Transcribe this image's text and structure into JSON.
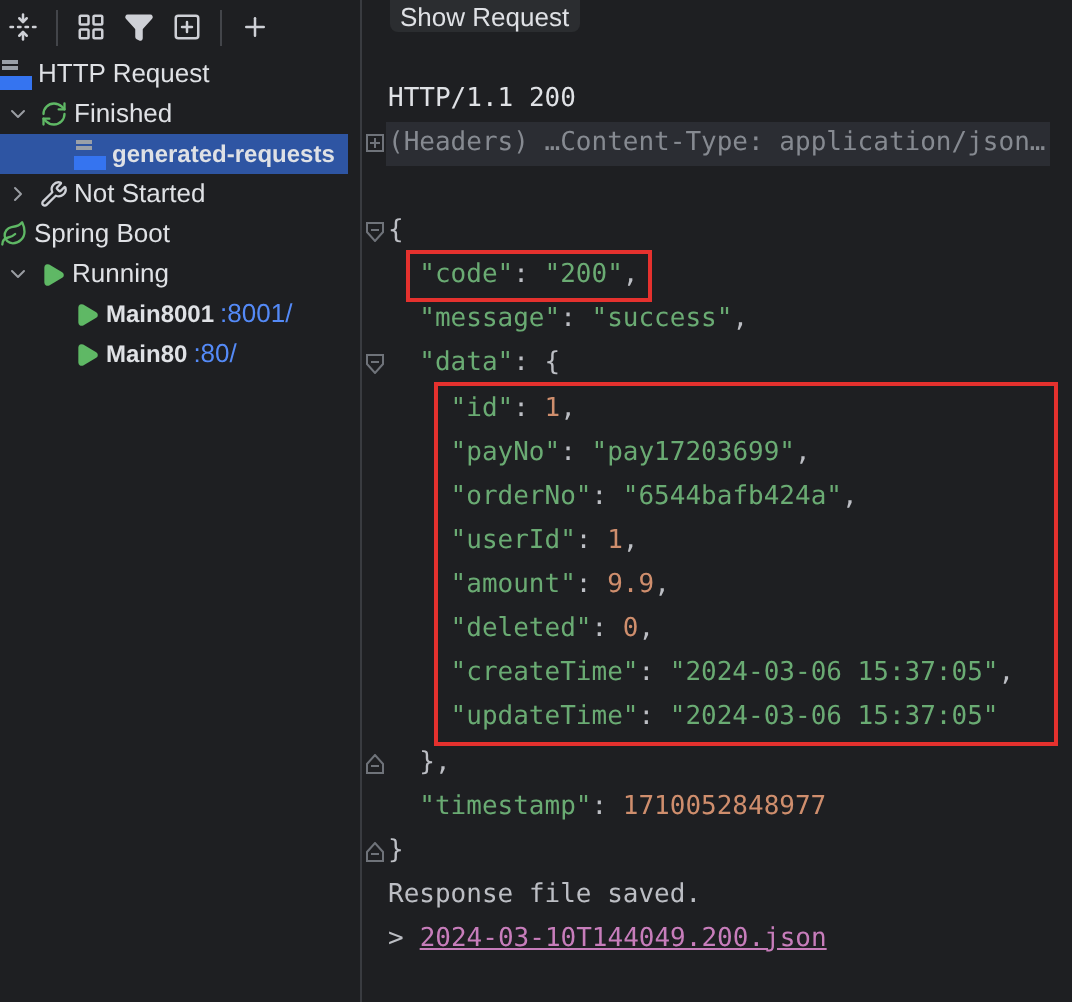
{
  "tree": [
    {
      "label": "HTTP Request",
      "kind": "api",
      "children": [
        {
          "label": "Finished",
          "kind": "refresh",
          "expanded": true,
          "children": [
            {
              "label": "generated-requests",
              "kind": "api",
              "bold": true,
              "selected": true
            }
          ]
        },
        {
          "label": "Not Started",
          "kind": "wrench",
          "expanded": false
        }
      ]
    },
    {
      "label": "Spring Boot",
      "kind": "spring",
      "children": [
        {
          "label": "Running",
          "kind": "run",
          "expanded": true,
          "children": [
            {
              "label": "Main8001",
              "suffix": ":8001/",
              "kind": "run",
              "bold": true,
              "selected": false
            },
            {
              "label": "Main80",
              "suffix": ":80/",
              "kind": "run",
              "bold": true,
              "selected": false
            }
          ]
        }
      ]
    }
  ],
  "show_request_button": "Show Request",
  "status_line": "HTTP/1.1 200",
  "headers_line": "(Headers) …Content-Type: application/json…",
  "body": [
    {
      "kind": "opener",
      "tokens": [
        {
          "kind": "punct",
          "text": "{"
        }
      ],
      "children": [
        {
          "highlighted": true,
          "tokens": [
            {
              "kind": "key",
              "text": "\"code\""
            },
            {
              "kind": "punct",
              "text": ": "
            },
            {
              "kind": "string",
              "text": "\"200\""
            },
            {
              "kind": "punct",
              "text": ","
            }
          ]
        },
        {
          "tokens": [
            {
              "kind": "key",
              "text": "\"message\""
            },
            {
              "kind": "punct",
              "text": ": "
            },
            {
              "kind": "string",
              "text": "\"success\""
            },
            {
              "kind": "punct",
              "text": ","
            }
          ]
        },
        {
          "kind": "opener",
          "tokens": [
            {
              "kind": "key",
              "text": "\"data\""
            },
            {
              "kind": "punct",
              "text": ": {"
            }
          ],
          "children_highlighted": true,
          "children": [
            {
              "tokens": [
                {
                  "kind": "key",
                  "text": "\"id\""
                },
                {
                  "kind": "punct",
                  "text": ": "
                },
                {
                  "kind": "number",
                  "text": "1"
                },
                {
                  "kind": "punct",
                  "text": ","
                }
              ]
            },
            {
              "tokens": [
                {
                  "kind": "key",
                  "text": "\"payNo\""
                },
                {
                  "kind": "punct",
                  "text": ": "
                },
                {
                  "kind": "string",
                  "text": "\"pay17203699\""
                },
                {
                  "kind": "punct",
                  "text": ","
                }
              ]
            },
            {
              "tokens": [
                {
                  "kind": "key",
                  "text": "\"orderNo\""
                },
                {
                  "kind": "punct",
                  "text": ": "
                },
                {
                  "kind": "string",
                  "text": "\"6544bafb424a\""
                },
                {
                  "kind": "punct",
                  "text": ","
                }
              ]
            },
            {
              "tokens": [
                {
                  "kind": "key",
                  "text": "\"userId\""
                },
                {
                  "kind": "punct",
                  "text": ": "
                },
                {
                  "kind": "number",
                  "text": "1"
                },
                {
                  "kind": "punct",
                  "text": ","
                }
              ]
            },
            {
              "tokens": [
                {
                  "kind": "key",
                  "text": "\"amount\""
                },
                {
                  "kind": "punct",
                  "text": ": "
                },
                {
                  "kind": "number",
                  "text": "9.9"
                },
                {
                  "kind": "punct",
                  "text": ","
                }
              ]
            },
            {
              "tokens": [
                {
                  "kind": "key",
                  "text": "\"deleted\""
                },
                {
                  "kind": "punct",
                  "text": ": "
                },
                {
                  "kind": "number",
                  "text": "0"
                },
                {
                  "kind": "punct",
                  "text": ","
                }
              ]
            },
            {
              "tokens": [
                {
                  "kind": "key",
                  "text": "\"createTime\""
                },
                {
                  "kind": "punct",
                  "text": ": "
                },
                {
                  "kind": "string",
                  "text": "\"2024-03-06 15:37:05\""
                },
                {
                  "kind": "punct",
                  "text": ","
                }
              ]
            },
            {
              "tokens": [
                {
                  "kind": "key",
                  "text": "\"updateTime\""
                },
                {
                  "kind": "punct",
                  "text": ": "
                },
                {
                  "kind": "string",
                  "text": "\"2024-03-06 15:37:05\""
                }
              ]
            }
          ]
        },
        {
          "kind": "closer",
          "tokens": [
            {
              "kind": "punct",
              "text": "},"
            }
          ]
        },
        {
          "tokens": [
            {
              "kind": "key",
              "text": "\"timestamp\""
            },
            {
              "kind": "punct",
              "text": ": "
            },
            {
              "kind": "number",
              "text": "1710052848977"
            }
          ]
        }
      ]
    },
    {
      "kind": "closer",
      "tokens": [
        {
          "kind": "punct",
          "text": "}"
        }
      ]
    }
  ],
  "saved_message": "Response file saved.",
  "link_prompt": ">",
  "saved_file_link": "2024-03-10T144049.200.json"
}
